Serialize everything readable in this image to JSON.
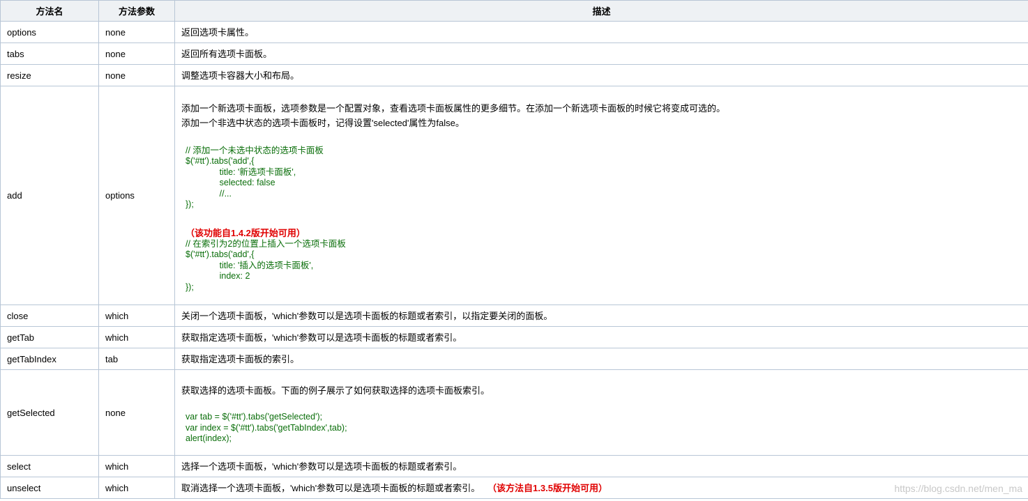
{
  "columns": [
    "方法名",
    "方法参数",
    "描述"
  ],
  "rows": [
    {
      "name": "options",
      "param": "none",
      "desc": [
        "返回选项卡属性。"
      ]
    },
    {
      "name": "tabs",
      "param": "none",
      "desc": [
        "返回所有选项卡面板。"
      ]
    },
    {
      "name": "resize",
      "param": "none",
      "desc": [
        "调整选项卡容器大小和布局。"
      ]
    },
    {
      "name": "add",
      "param": "options",
      "desc": [
        "添加一个新选项卡面板，选项参数是一个配置对象，查看选项卡面板属性的更多细节。在添加一个新选项卡面板的时候它将变成可选的。",
        "添加一个非选中状态的选项卡面板时，记得设置'selected'属性为false。"
      ],
      "code1": "// 添加一个未选中状态的选项卡面板\n$('#tt').tabs('add',{\n              title: '新选项卡面板',\n              selected: false\n              //...\n});",
      "note": "（该功能自1.4.2版开始可用）",
      "code2": "// 在索引为2的位置上插入一个选项卡面板\n$('#tt').tabs('add',{\n              title: '插入的选项卡面板',\n              index: 2\n});"
    },
    {
      "name": "close",
      "param": "which",
      "desc": [
        "关闭一个选项卡面板，'which'参数可以是选项卡面板的标题或者索引，以指定要关闭的面板。"
      ]
    },
    {
      "name": "getTab",
      "param": "which",
      "desc": [
        "获取指定选项卡面板，'which'参数可以是选项卡面板的标题或者索引。"
      ]
    },
    {
      "name": "getTabIndex",
      "param": "tab",
      "desc": [
        "获取指定选项卡面板的索引。"
      ]
    },
    {
      "name": "getSelected",
      "param": "none",
      "desc": [
        "获取选择的选项卡面板。下面的例子展示了如何获取选择的选项卡面板索引。"
      ],
      "code1": "var tab = $('#tt').tabs('getSelected');\nvar index = $('#tt').tabs('getTabIndex',tab);\nalert(index);"
    },
    {
      "name": "select",
      "param": "which",
      "desc": [
        "选择一个选项卡面板，'which'参数可以是选项卡面板的标题或者索引。"
      ]
    },
    {
      "name": "unselect",
      "param": "which",
      "desc": [
        "取消选择一个选项卡面板，'which'参数可以是选项卡面板的标题或者索引。"
      ],
      "note": "（该方法自1.3.5版开始可用）"
    }
  ],
  "watermark": "https://blog.csdn.net/men_ma"
}
